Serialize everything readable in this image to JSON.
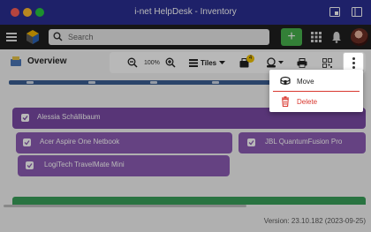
{
  "window": {
    "title": "i-net HelpDesk - Inventory"
  },
  "header": {
    "search_placeholder": "Search",
    "add_label": "+"
  },
  "page": {
    "title": "Overview"
  },
  "toolbar": {
    "zoom": "100%",
    "view_label": "Tiles",
    "badge_count": "4"
  },
  "items": {
    "group_name": "Alessia Schällibaum",
    "cards": [
      {
        "label": "Acer Aspire One Netbook"
      },
      {
        "label": "JBL QuantumFusion Pro"
      },
      {
        "label": "LogiTech TravelMate Mini"
      }
    ]
  },
  "menu": {
    "move_label": "Move",
    "delete_label": "Delete"
  },
  "footer": {
    "version": "Version: 23.10.182 (2023-09-25)"
  },
  "colors": {
    "titlebar": "#2a2f92",
    "appbar": "#1f1f1f",
    "accent_green": "#47b24d",
    "group_purple": "#7b4aa6",
    "card_purple": "#8d5cb4",
    "delete_red": "#d9382f"
  },
  "icons": {
    "hamburger": "menu-icon",
    "logo": "app-logo",
    "search": "search-icon",
    "grid": "apps-grid-icon",
    "bell": "bell-icon",
    "zoom_out": "zoom-out-icon",
    "zoom_in": "zoom-in-icon",
    "basket": "basket-icon",
    "assign": "assign-user-icon",
    "print": "print-icon",
    "qr": "qr-code-icon",
    "more": "more-vertical-icon",
    "move": "move-icon",
    "delete": "trash-icon"
  }
}
